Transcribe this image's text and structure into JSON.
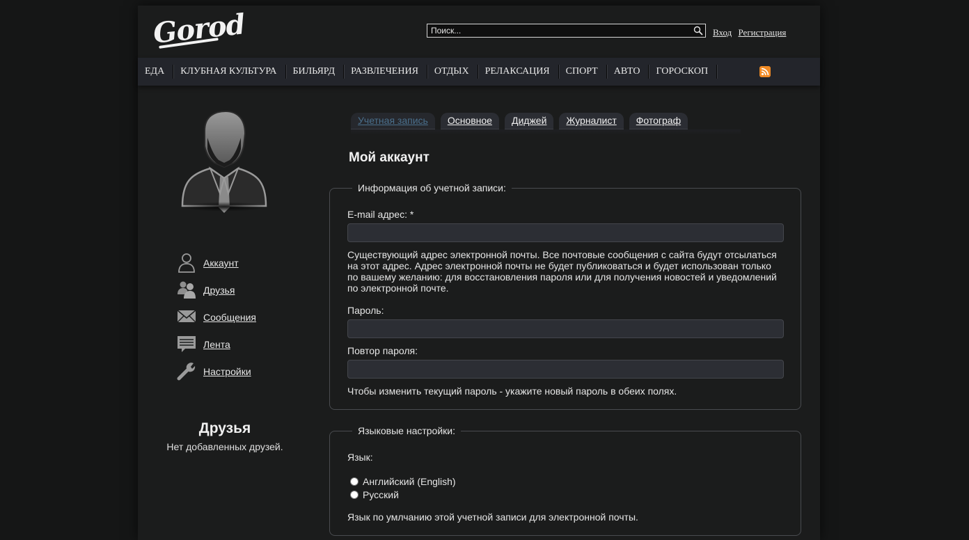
{
  "header": {
    "logo_text": "Gorod",
    "search_placeholder": "Поиск...",
    "login_link": "Вход",
    "register_link": "Регистрация"
  },
  "nav": {
    "items": [
      "ЕДА",
      "КЛУБНАЯ КУЛЬТУРА",
      "БИЛЬЯРД",
      "РАЗВЛЕЧЕНИЯ",
      "ОТДЫХ",
      "РЕЛАКСАЦИЯ",
      "СПОРТ",
      "АВТО",
      "ГОРОСКОП"
    ],
    "rss_icon": "rss-icon"
  },
  "sidebar": {
    "menu": [
      {
        "label": "Аккаунт",
        "icon": "user-icon"
      },
      {
        "label": "Друзья",
        "icon": "friends-icon"
      },
      {
        "label": "Сообщения",
        "icon": "envelope-icon"
      },
      {
        "label": "Лента",
        "icon": "feed-icon"
      },
      {
        "label": "Настройки",
        "icon": "wrench-icon"
      }
    ],
    "friends_title": "Друзья",
    "friends_empty": "Нет добавленных друзей."
  },
  "tabs": [
    "Учетная запись",
    "Основное",
    "Диджей",
    "Журналист",
    "Фотограф"
  ],
  "active_tab": "Учетная запись",
  "page_title": "Мой аккаунт",
  "account_info": {
    "legend": "Информация об учетной записи:",
    "email_label": "E-mail адрес: *",
    "email_value": "",
    "email_desc": "Существующий адрес электронной почты. Все почтовые сообщения с сайта будут отсылаться на этот адрес. Адрес электронной почты не будет публиковаться и будет использован только по вашему желанию: для восстановления пароля или для получения новостей и уведомлений по электронной почте.",
    "password_label": "Пароль:",
    "password_confirm_label": "Повтор пароля:",
    "password_hint": "Чтобы изменить текущий пароль - укажите новый пароль в обеих полях."
  },
  "language": {
    "legend": "Языковые настройки:",
    "label": "Язык:",
    "options": [
      "Английский (English)",
      "Русский"
    ],
    "desc": "Язык по умлчанию этой учетной записи для электронной почты."
  },
  "colors": {
    "background": "#151616",
    "panel": "#1b1c1c",
    "nav": "#23252b",
    "active_tab_text": "#4a6f8c",
    "rss": "#f08a24"
  }
}
